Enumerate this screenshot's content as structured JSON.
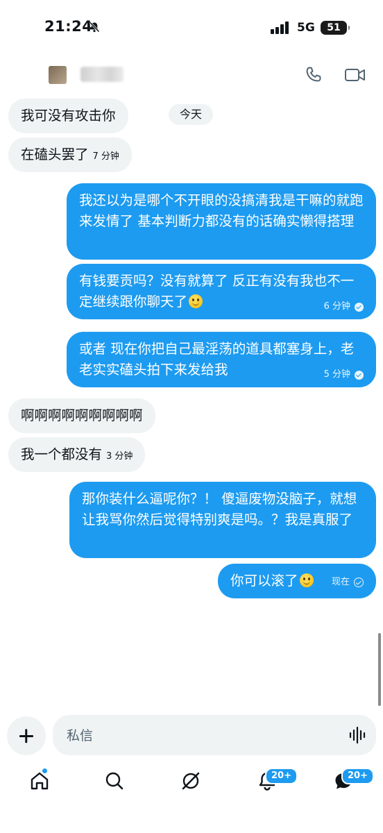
{
  "status_bar": {
    "time": "21:24",
    "network": "5G",
    "battery": "51"
  },
  "conversation": {
    "today_label": "今天"
  },
  "messages": [
    {
      "side": "in",
      "text": "我可没有攻击你",
      "time": ""
    },
    {
      "side": "in",
      "text": "在磕头罢了",
      "time": "7 分钟"
    },
    {
      "side": "out",
      "text": "我还以为是哪个不开眼的没搞清我是干嘛的就跑来发情了 基本判断力都没有的话确实懒得搭理",
      "time": ""
    },
    {
      "side": "out",
      "text": "有钱要贡吗？没有就算了 反正有没有我也不一定继续跟你聊天了",
      "time": "6 分钟"
    },
    {
      "side": "out",
      "text": "或者 现在你把自己最淫荡的道具都塞身上，老老实实磕头拍下来发给我",
      "time": "5 分钟"
    },
    {
      "side": "in",
      "text": "啊啊啊啊啊啊啊啊啊",
      "time": ""
    },
    {
      "side": "in",
      "text": "我一个都没有",
      "time": "3 分钟"
    },
    {
      "side": "out",
      "text": "那你装什么逼呢你？！ 傻逼废物没脑子，就想让我骂你然后觉得特别爽是吗。？我是真服了",
      "time": ""
    },
    {
      "side": "out",
      "text": "你可以滚了",
      "time": "现在"
    }
  ],
  "composer": {
    "placeholder": "私信"
  },
  "nav": {
    "notifications_badge": "20+",
    "messages_badge": "20+"
  },
  "colors": {
    "accent": "#1d9bf0",
    "incoming_bubble": "#eff3f4",
    "text": "#0f1419"
  }
}
